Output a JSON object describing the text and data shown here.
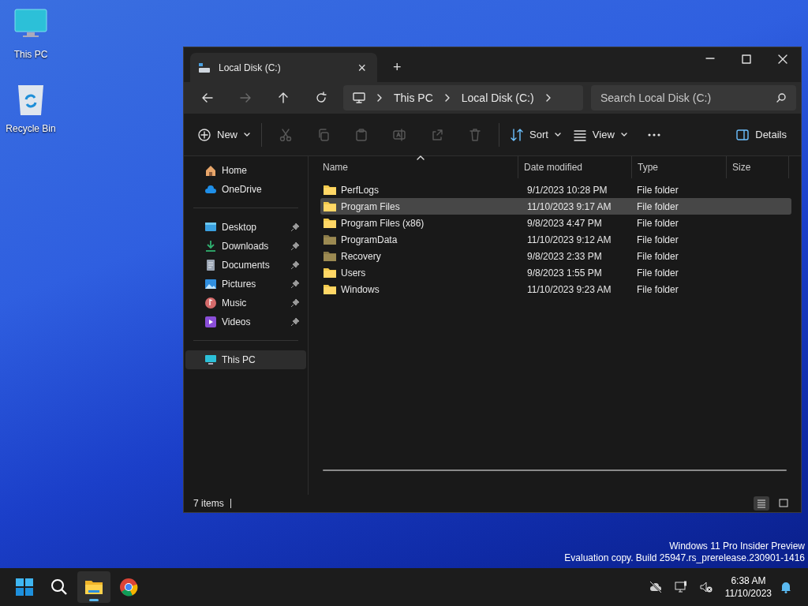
{
  "desktop_icons": [
    {
      "kind": "pc",
      "label": "This PC"
    },
    {
      "kind": "bin",
      "label": "Recycle Bin"
    }
  ],
  "window": {
    "tab": {
      "title": "Local Disk (C:)",
      "close": "×"
    },
    "new_tab": "+"
  },
  "navigation": [
    {
      "kind": "back",
      "disabled": false
    },
    {
      "kind": "forward",
      "disabled": true
    },
    {
      "kind": "up",
      "disabled": false
    },
    {
      "kind": "refresh",
      "disabled": false
    }
  ],
  "breadcrumb": [
    "This PC",
    "Local Disk (C:)"
  ],
  "search": {
    "placeholder": "Search Local Disk (C:)"
  },
  "toolbar": [
    {
      "kind": "new",
      "label": "New",
      "disabled": false
    },
    {
      "kind": "cut",
      "disabled": true
    },
    {
      "kind": "copy",
      "disabled": true
    },
    {
      "kind": "paste",
      "disabled": true
    },
    {
      "kind": "rename",
      "disabled": true
    },
    {
      "kind": "share",
      "disabled": true
    },
    {
      "kind": "delete",
      "disabled": true
    },
    {
      "kind": "sort",
      "label": "Sort",
      "disabled": false
    },
    {
      "kind": "view",
      "label": "View",
      "disabled": false
    },
    {
      "kind": "more",
      "disabled": false
    },
    {
      "kind": "details",
      "label": "Details",
      "disabled": false
    }
  ],
  "sidebar": {
    "groups": [
      [
        {
          "kind": "home",
          "label": "Home",
          "pinned": false,
          "selected": false
        },
        {
          "kind": "cloud",
          "label": "OneDrive",
          "pinned": false,
          "selected": false
        }
      ],
      [
        {
          "kind": "desktop",
          "label": "Desktop",
          "pinned": true,
          "selected": false
        },
        {
          "kind": "downloads",
          "label": "Downloads",
          "pinned": true,
          "selected": false
        },
        {
          "kind": "documents",
          "label": "Documents",
          "pinned": true,
          "selected": false
        },
        {
          "kind": "pictures",
          "label": "Pictures",
          "pinned": true,
          "selected": false
        },
        {
          "kind": "music",
          "label": "Music",
          "pinned": true,
          "selected": false
        },
        {
          "kind": "videos",
          "label": "Videos",
          "pinned": true,
          "selected": false
        }
      ],
      [
        {
          "kind": "pc",
          "label": "This PC",
          "pinned": false,
          "selected": true
        }
      ]
    ]
  },
  "table": {
    "columns": [
      "Name",
      "Date modified",
      "Type",
      "Size"
    ],
    "rows": [
      {
        "name": "PerfLogs",
        "date": "9/1/2023 10:28 PM",
        "type": "File folder",
        "hidden": false,
        "selected": false
      },
      {
        "name": "Program Files",
        "date": "11/10/2023 9:17 AM",
        "type": "File folder",
        "hidden": false,
        "selected": true
      },
      {
        "name": "Program Files (x86)",
        "date": "9/8/2023 4:47 PM",
        "type": "File folder",
        "hidden": false,
        "selected": false
      },
      {
        "name": "ProgramData",
        "date": "11/10/2023 9:12 AM",
        "type": "File folder",
        "hidden": true,
        "selected": false
      },
      {
        "name": "Recovery",
        "date": "9/8/2023 2:33 PM",
        "type": "File folder",
        "hidden": true,
        "selected": false
      },
      {
        "name": "Users",
        "date": "9/8/2023 1:55 PM",
        "type": "File folder",
        "hidden": false,
        "selected": false
      },
      {
        "name": "Windows",
        "date": "11/10/2023 9:23 AM",
        "type": "File folder",
        "hidden": false,
        "selected": false
      }
    ]
  },
  "status_bar": {
    "count": "7 items",
    "layout": [
      {
        "kind": "list",
        "selected": true
      },
      {
        "kind": "tiles",
        "selected": false
      }
    ]
  },
  "watermark_text": [
    "Windows 11 Pro Insider Preview",
    "Evaluation copy. Build 25947.rs_prerelease.230901-1416"
  ],
  "taskbar": {
    "apps": [
      {
        "kind": "start",
        "selected": false
      },
      {
        "kind": "search",
        "selected": false
      },
      {
        "kind": "explorer",
        "selected": true
      },
      {
        "kind": "browser",
        "selected": false
      }
    ],
    "tray": [
      {
        "kind": "cloud-off"
      },
      {
        "kind": "network"
      },
      {
        "kind": "mute"
      }
    ],
    "time": "6:38 AM",
    "date": "11/10/2023"
  }
}
